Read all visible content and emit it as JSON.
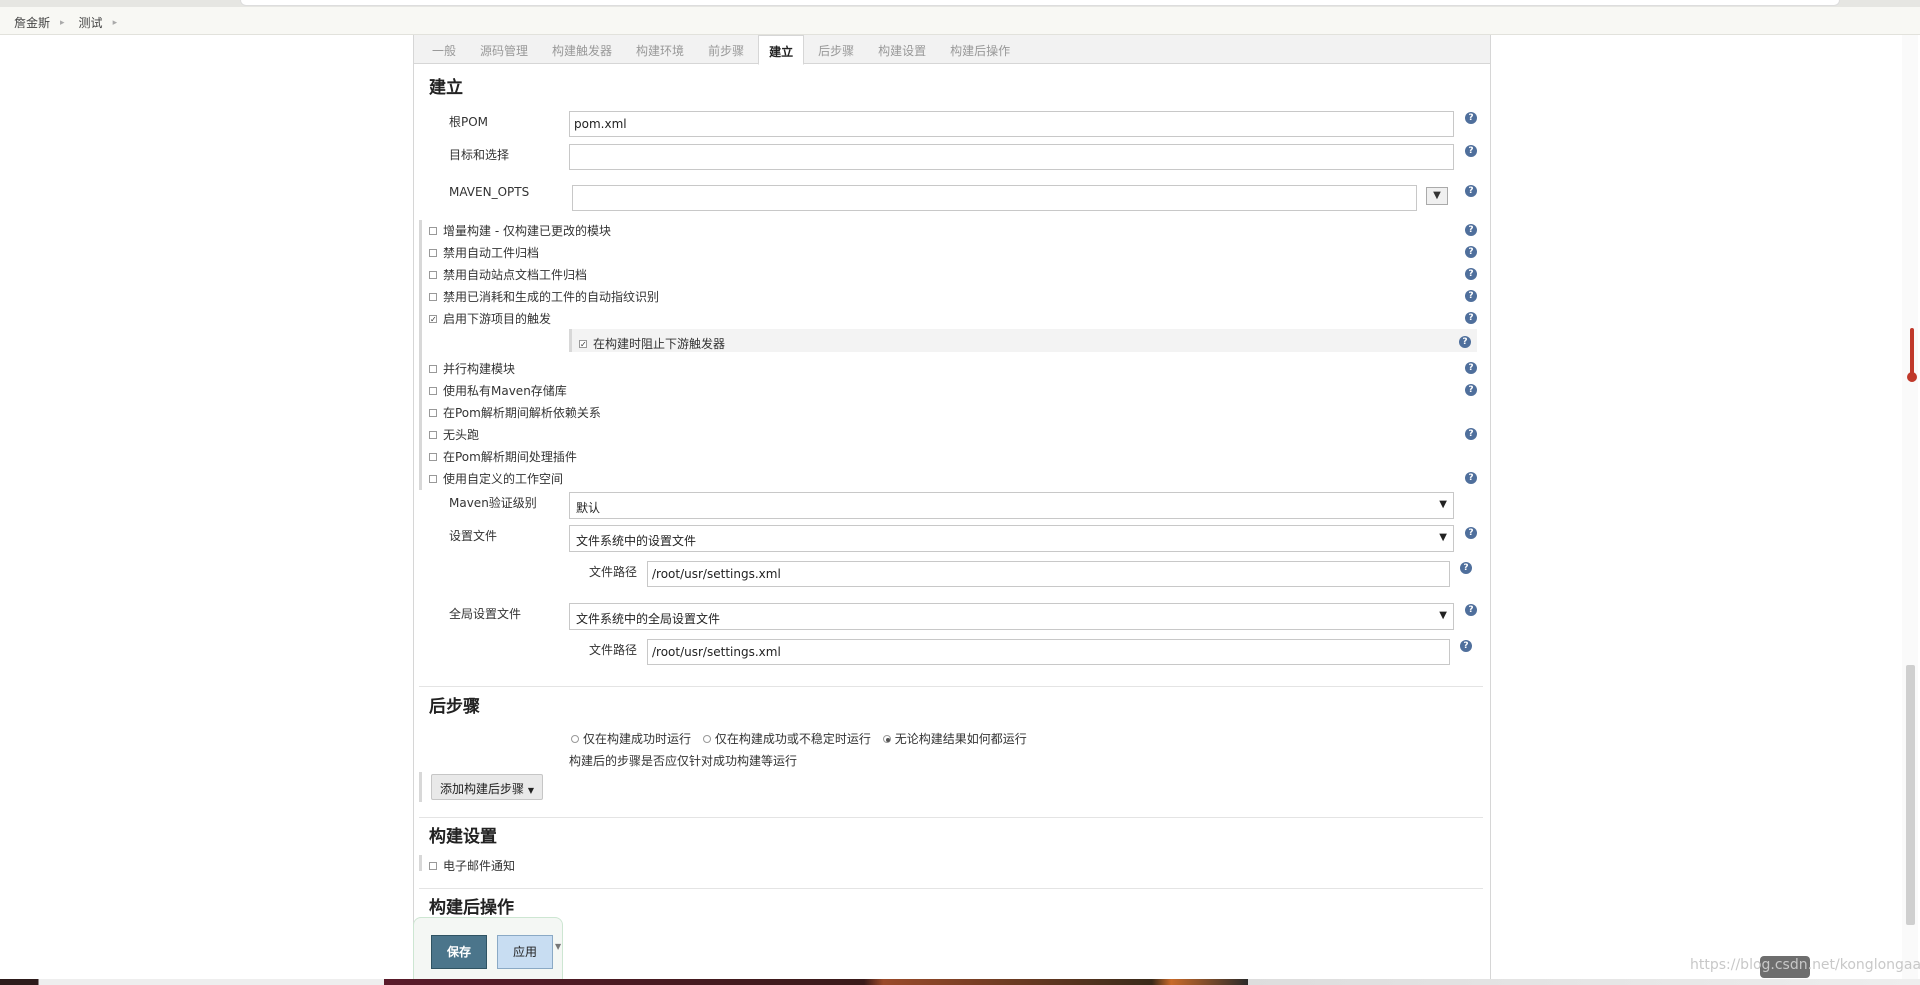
{
  "breadcrumb": {
    "items": [
      "詹金斯",
      "测试"
    ]
  },
  "tabs": [
    "一般",
    "源码管理",
    "构建触发器",
    "构建环境",
    "前步骤",
    "建立",
    "后步骤",
    "构建设置",
    "构建后操作"
  ],
  "build": {
    "title": "建立",
    "root_pom_label": "根POM",
    "root_pom_value": "pom.xml",
    "goals_label": "目标和选择",
    "goals_value": "",
    "maven_opts_label": "MAVEN_OPTS",
    "maven_opts_value": "",
    "options": {
      "incremental": "增量构建 - 仅构建已更改的模块",
      "disable_artifact": "禁用自动工件归档",
      "disable_site": "禁用自动站点文档工件归档",
      "disable_fingerprint": "禁用已消耗和生成的工件的自动指纹识别",
      "enable_downstream": "启用下游项目的触发",
      "block_downstream": "在构建时阻止下游触发器",
      "parallel": "并行构建模块",
      "private_repo": "使用私有Maven存储库",
      "resolve_deps": "在Pom解析期间解析依赖关系",
      "headless": "无头跑",
      "process_plugins": "在Pom解析期间处理插件",
      "custom_workspace": "使用自定义的工作空间"
    },
    "validation_label": "Maven验证级别",
    "validation_value": "默认",
    "settings_label": "设置文件",
    "settings_value": "文件系统中的设置文件",
    "path_label": "文件路径",
    "settings_path": "/root/usr/settings.xml",
    "global_settings_label": "全局设置文件",
    "global_settings_value": "文件系统中的全局设置文件",
    "global_path_label": "文件路径",
    "global_settings_path": "/root/usr/settings.xml"
  },
  "post_steps": {
    "title": "后步骤",
    "radio_success": "仅在构建成功时运行",
    "radio_unstable": "仅在构建成功或不稳定时运行",
    "radio_always": "无论构建结果如何都运行",
    "hint": "构建后的步骤是否应仅针对成功构建等运行",
    "add_button": "添加构建后步骤"
  },
  "build_settings": {
    "title": "构建设置",
    "email": "电子邮件通知"
  },
  "post_build": {
    "title": "构建后操作"
  },
  "actions": {
    "save": "保存",
    "apply": "应用"
  },
  "watermark": "https://blog.csdn.net/konglongaa"
}
